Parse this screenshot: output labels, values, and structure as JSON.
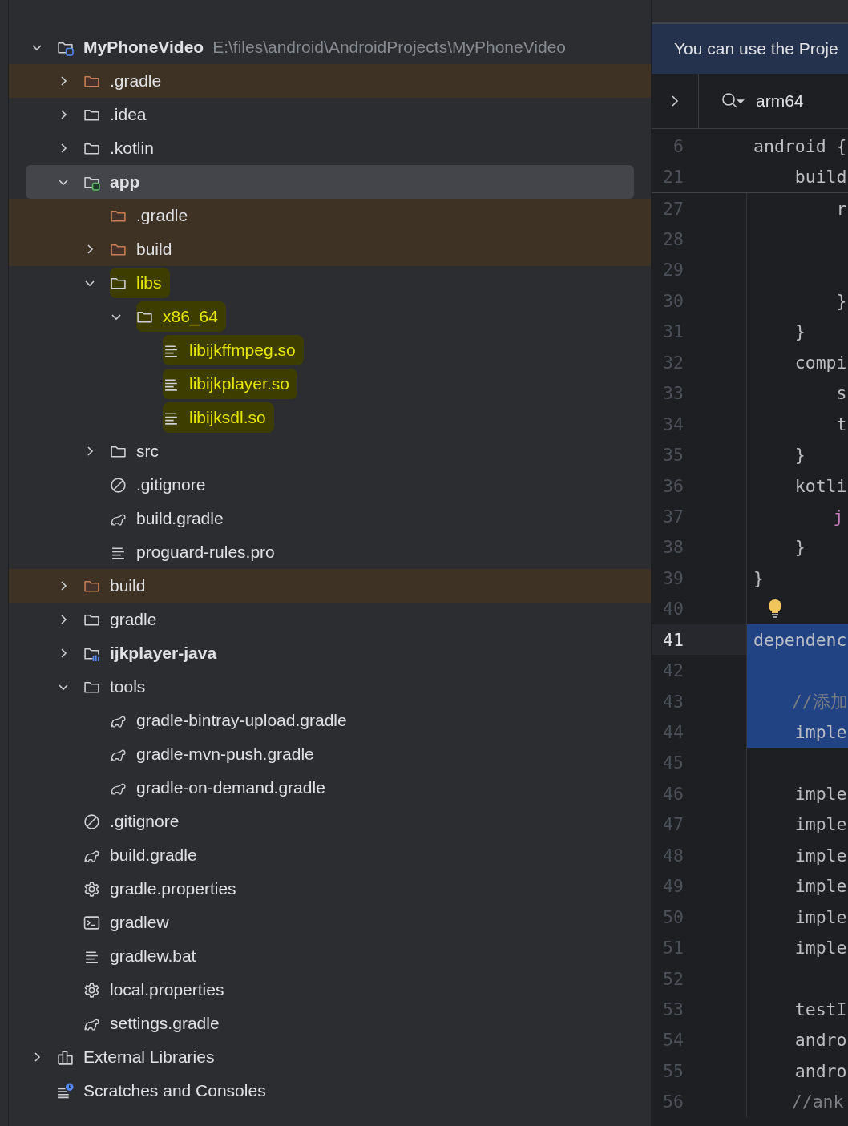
{
  "project_tree": [
    {
      "label": "MyPhoneVideo",
      "path": "E:\\files\\android\\AndroidProjects\\MyPhoneVideo",
      "kind": "project",
      "expanded": true,
      "selected": false,
      "excluded": false,
      "marked": false,
      "children": [
        {
          "label": ".gradle",
          "kind": "folder",
          "expanded": false,
          "selected": false,
          "excluded": true,
          "marked": false
        },
        {
          "label": ".idea",
          "kind": "folder",
          "expanded": false,
          "selected": false,
          "excluded": false,
          "marked": false
        },
        {
          "label": ".kotlin",
          "kind": "folder",
          "expanded": false,
          "selected": false,
          "excluded": false,
          "marked": false
        },
        {
          "label": "app",
          "kind": "app-module",
          "expanded": true,
          "selected": true,
          "excluded": false,
          "marked": false,
          "children": [
            {
              "label": ".gradle",
              "kind": "folder",
              "selected": false,
              "excluded": true,
              "marked": false
            },
            {
              "label": "build",
              "kind": "folder",
              "expanded": false,
              "selected": false,
              "excluded": true,
              "marked": false
            },
            {
              "label": "libs",
              "kind": "folder",
              "expanded": true,
              "selected": false,
              "excluded": false,
              "marked": true,
              "children": [
                {
                  "label": "x86_64",
                  "kind": "folder",
                  "expanded": true,
                  "selected": false,
                  "excluded": false,
                  "marked": true,
                  "children": [
                    {
                      "label": "libijkffmpeg.so",
                      "kind": "text",
                      "selected": false,
                      "excluded": false,
                      "marked": true
                    },
                    {
                      "label": "libijkplayer.so",
                      "kind": "text",
                      "selected": false,
                      "excluded": false,
                      "marked": true
                    },
                    {
                      "label": "libijksdl.so",
                      "kind": "text",
                      "selected": false,
                      "excluded": false,
                      "marked": true
                    }
                  ]
                }
              ]
            },
            {
              "label": "src",
              "kind": "folder",
              "expanded": false,
              "selected": false,
              "excluded": false,
              "marked": false
            },
            {
              "label": ".gitignore",
              "kind": "ignore",
              "selected": false,
              "excluded": false,
              "marked": false
            },
            {
              "label": "build.gradle",
              "kind": "gradle",
              "selected": false,
              "excluded": false,
              "marked": false
            },
            {
              "label": "proguard-rules.pro",
              "kind": "text",
              "selected": false,
              "excluded": false,
              "marked": false
            }
          ]
        },
        {
          "label": "build",
          "kind": "folder",
          "expanded": false,
          "selected": false,
          "excluded": true,
          "marked": false
        },
        {
          "label": "gradle",
          "kind": "folder",
          "expanded": false,
          "selected": false,
          "excluded": false,
          "marked": false
        },
        {
          "label": "ijkplayer-java",
          "kind": "library-module",
          "expanded": false,
          "selected": false,
          "excluded": false,
          "marked": false
        },
        {
          "label": "tools",
          "kind": "folder",
          "expanded": true,
          "selected": false,
          "excluded": false,
          "marked": false,
          "children": [
            {
              "label": "gradle-bintray-upload.gradle",
              "kind": "gradle",
              "selected": false,
              "excluded": false,
              "marked": false
            },
            {
              "label": "gradle-mvn-push.gradle",
              "kind": "gradle",
              "selected": false,
              "excluded": false,
              "marked": false
            },
            {
              "label": "gradle-on-demand.gradle",
              "kind": "gradle",
              "selected": false,
              "excluded": false,
              "marked": false
            }
          ]
        },
        {
          "label": ".gitignore",
          "kind": "ignore",
          "selected": false,
          "excluded": false,
          "marked": false
        },
        {
          "label": "build.gradle",
          "kind": "gradle",
          "selected": false,
          "excluded": false,
          "marked": false
        },
        {
          "label": "gradle.properties",
          "kind": "gear",
          "selected": false,
          "excluded": false,
          "marked": false
        },
        {
          "label": "gradlew",
          "kind": "terminal",
          "selected": false,
          "excluded": false,
          "marked": false
        },
        {
          "label": "gradlew.bat",
          "kind": "text",
          "selected": false,
          "excluded": false,
          "marked": false
        },
        {
          "label": "local.properties",
          "kind": "gear",
          "selected": false,
          "excluded": false,
          "marked": false
        },
        {
          "label": "settings.gradle",
          "kind": "gradle",
          "selected": false,
          "excluded": false,
          "marked": false
        }
      ]
    },
    {
      "label": "External Libraries",
      "kind": "libraries",
      "expanded": false,
      "selected": false,
      "excluded": false,
      "marked": false
    },
    {
      "label": "Scratches and Consoles",
      "kind": "scratches",
      "selected": false,
      "excluded": false,
      "marked": false
    }
  ],
  "editor": {
    "banner": "You can use the Proje",
    "search_value": "arm64",
    "lines": [
      {
        "number": "6",
        "text": "android {",
        "kind": "code",
        "sticky": true,
        "selected": false,
        "current": false
      },
      {
        "number": "21",
        "text": "    build",
        "kind": "code",
        "sticky": true,
        "selected": false,
        "current": false
      },
      {
        "number": "27",
        "text": "        r",
        "kind": "code",
        "sticky": false,
        "selected": false,
        "current": false
      },
      {
        "number": "28",
        "sticky": false,
        "selected": false,
        "current": false
      },
      {
        "number": "29",
        "sticky": false,
        "selected": false,
        "current": false
      },
      {
        "number": "30",
        "text": "        }",
        "kind": "code",
        "sticky": false,
        "selected": false,
        "current": false
      },
      {
        "number": "31",
        "text": "    }",
        "kind": "code",
        "sticky": false,
        "selected": false,
        "current": false
      },
      {
        "number": "32",
        "text": "    compi",
        "kind": "code",
        "sticky": false,
        "selected": false,
        "current": false
      },
      {
        "number": "33",
        "text": "        s",
        "kind": "code",
        "sticky": false,
        "selected": false,
        "current": false
      },
      {
        "number": "34",
        "text": "        t",
        "kind": "code",
        "sticky": false,
        "selected": false,
        "current": false
      },
      {
        "number": "35",
        "text": "    }",
        "kind": "code",
        "sticky": false,
        "selected": false,
        "current": false
      },
      {
        "number": "36",
        "text": "    kotli",
        "kind": "code",
        "sticky": false,
        "selected": false,
        "current": false
      },
      {
        "number": "37",
        "text": "        j",
        "kind": "named-arg",
        "sticky": false,
        "selected": false,
        "current": false
      },
      {
        "number": "38",
        "text": "    }",
        "kind": "code",
        "sticky": false,
        "selected": false,
        "current": false
      },
      {
        "number": "39",
        "text": "}",
        "kind": "code",
        "sticky": false,
        "selected": false,
        "current": false
      },
      {
        "number": "40",
        "sticky": false,
        "selected": false,
        "current": false,
        "bulb": true
      },
      {
        "number": "41",
        "text": "dependenc",
        "kind": "code",
        "sticky": false,
        "selected": true,
        "current": true
      },
      {
        "number": "42",
        "sticky": false,
        "selected": true,
        "current": false
      },
      {
        "number": "43",
        "text": "    //添加",
        "kind": "comment",
        "sticky": false,
        "selected": true,
        "current": false
      },
      {
        "number": "44",
        "text": "    imple",
        "kind": "code",
        "sticky": false,
        "selected": true,
        "current": false
      },
      {
        "number": "45",
        "sticky": false,
        "selected": false,
        "current": false
      },
      {
        "number": "46",
        "text": "    imple",
        "kind": "code",
        "sticky": false,
        "selected": false,
        "current": false
      },
      {
        "number": "47",
        "text": "    imple",
        "kind": "code",
        "sticky": false,
        "selected": false,
        "current": false
      },
      {
        "number": "48",
        "text": "    imple",
        "kind": "code",
        "sticky": false,
        "selected": false,
        "current": false
      },
      {
        "number": "49",
        "text": "    imple",
        "kind": "code",
        "sticky": false,
        "selected": false,
        "current": false
      },
      {
        "number": "50",
        "text": "    imple",
        "kind": "code",
        "sticky": false,
        "selected": false,
        "current": false
      },
      {
        "number": "51",
        "text": "    imple",
        "kind": "code",
        "sticky": false,
        "selected": false,
        "current": false
      },
      {
        "number": "52",
        "sticky": false,
        "selected": false,
        "current": false
      },
      {
        "number": "53",
        "text": "    testI",
        "kind": "code",
        "sticky": false,
        "selected": false,
        "current": false
      },
      {
        "number": "54",
        "text": "    andro",
        "kind": "code",
        "sticky": false,
        "selected": false,
        "current": false
      },
      {
        "number": "55",
        "text": "    andro",
        "kind": "code",
        "sticky": false,
        "selected": false,
        "current": false
      },
      {
        "number": "56",
        "text": "    //ank",
        "kind": "comment",
        "sticky": false,
        "selected": false,
        "current": false
      }
    ]
  }
}
